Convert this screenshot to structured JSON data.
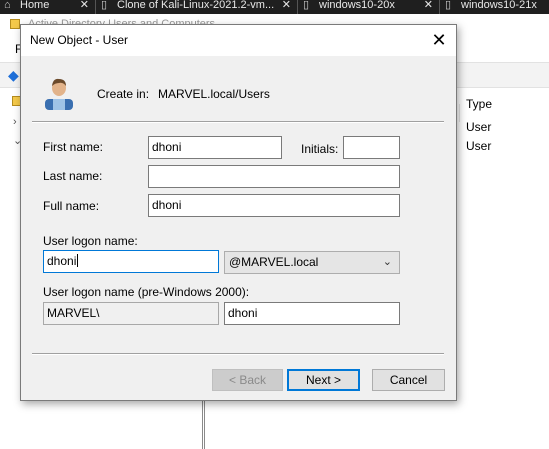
{
  "host_tabs": [
    {
      "label": "Home",
      "icon": "home-icon"
    },
    {
      "label": "Clone of Kali-Linux-2021.2-vm...",
      "icon": "vm-icon"
    },
    {
      "label": "windows10-20x",
      "icon": "vm-icon"
    },
    {
      "label": "windows10-21x",
      "icon": "vm-icon"
    }
  ],
  "background": {
    "title": "Active Directory Users and Computers",
    "menu_letter": "F",
    "list_header": "Type",
    "list_rows": [
      "User",
      "User"
    ]
  },
  "dialog": {
    "title": "New Object - User",
    "create_in_label": "Create in:",
    "create_in_path": "MARVEL.local/Users",
    "first_name_label": "First name:",
    "first_name_value": "dhoni",
    "initials_label": "Initials:",
    "initials_value": "",
    "last_name_label": "Last name:",
    "last_name_value": "",
    "full_name_label": "Full name:",
    "full_name_value": "dhoni",
    "logon_label": "User logon name:",
    "logon_value": "dhoni",
    "domain_suffix": "@MARVEL.local",
    "pre2000_label": "User logon name (pre-Windows 2000):",
    "pre2000_domain": "MARVEL\\",
    "pre2000_value": "dhoni",
    "buttons": {
      "back": "< Back",
      "next": "Next >",
      "cancel": "Cancel"
    }
  },
  "colors": {
    "accent": "#0078d7",
    "dialog_bg": "#f0f0f0",
    "host_tab_bg": "#1f1f1f"
  }
}
